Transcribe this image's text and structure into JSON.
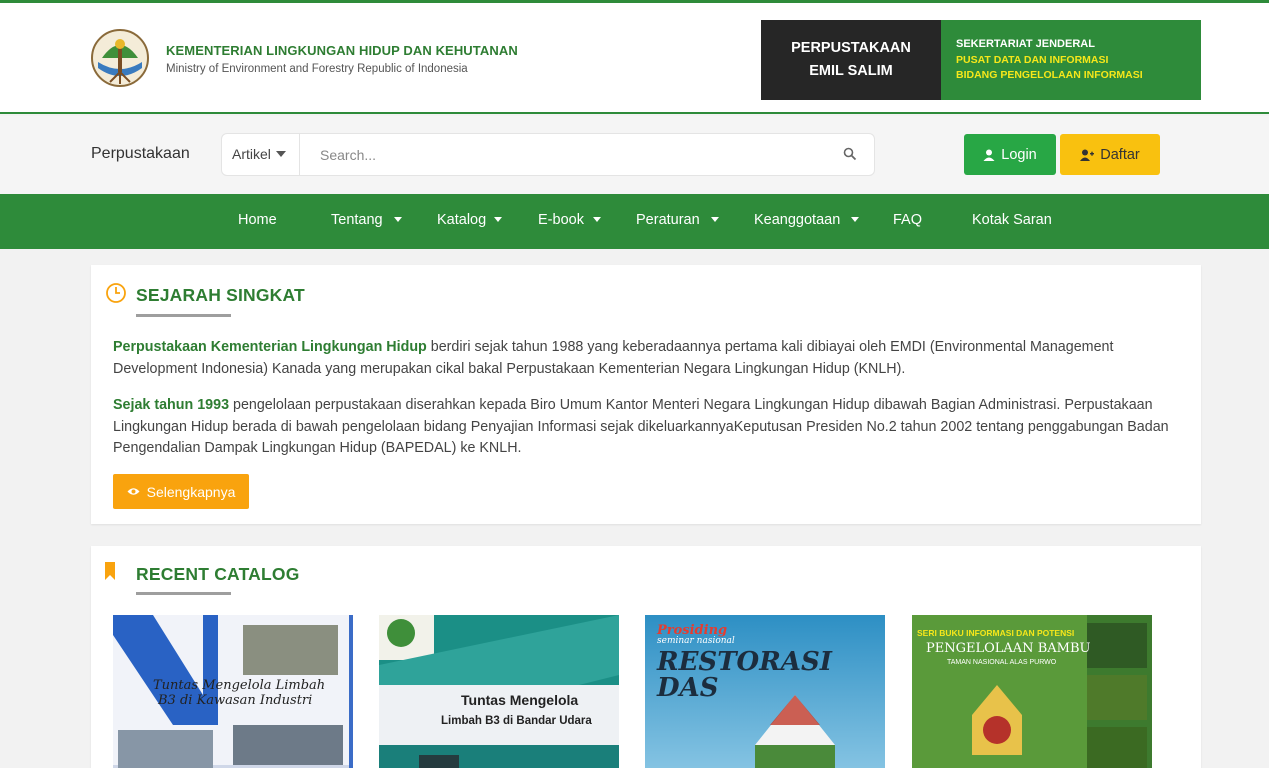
{
  "header": {
    "ministry_name": "KEMENTERIAN LINGKUNGAN HIDUP DAN KEHUTANAN",
    "ministry_subtitle": "Ministry of Environment and Forestry Republic of Indonesia",
    "library_line1": "PERPUSTAKAAN",
    "library_line2": "EMIL SALIM",
    "secretariat_line1": "SEKERTARIAT JENDERAL",
    "secretariat_line2": "PUSAT DATA DAN INFORMASI",
    "secretariat_line3": "BIDANG PENGELOLAAN INFORMASI"
  },
  "searchbar": {
    "brand": "Perpustakaan",
    "category": "Artikel",
    "placeholder": "Search...",
    "login_label": "Login",
    "register_label": "Daftar"
  },
  "nav": {
    "items": [
      {
        "label": "Home",
        "dropdown": false
      },
      {
        "label": "Tentang",
        "dropdown": true
      },
      {
        "label": "Katalog",
        "dropdown": true
      },
      {
        "label": "E-book",
        "dropdown": true
      },
      {
        "label": "Peraturan",
        "dropdown": true
      },
      {
        "label": "Keanggotaan",
        "dropdown": true
      },
      {
        "label": "FAQ",
        "dropdown": false
      },
      {
        "label": "Kotak Saran",
        "dropdown": false
      }
    ]
  },
  "history": {
    "title": "SEJARAH SINGKAT",
    "p1_bold": "Perpustakaan Kementerian Lingkungan Hidup",
    "p1_rest": " berdiri sejak tahun 1988 yang keberadaannya pertama kali dibiayai oleh EMDI (Environmental Management Development Indonesia) Kanada yang merupakan cikal bakal Perpustakaan Kementerian Negara Lingkungan Hidup (KNLH).",
    "p2_bold": "Sejak tahun 1993",
    "p2_rest": " pengelolaan perpustakaan diserahkan kepada Biro Umum Kantor Menteri Negara Lingkungan Hidup dibawah Bagian Administrasi. Perpustakaan Lingkungan Hidup berada di bawah pengelolaan bidang Penyajian Informasi sejak dikeluarkannyaKeputusan Presiden No.2 tahun 2002 tentang penggabungan Badan Pengendalian Dampak Lingkungan Hidup (BAPEDAL) ke KNLH.",
    "more_label": "Selengkapnya"
  },
  "catalog": {
    "title": "RECENT CATALOG",
    "books": [
      {
        "cover_line1": "Tuntas Mengelola Limbah",
        "cover_line2": "B3 di Kawasan Industri"
      },
      {
        "cover_line1": "Tuntas Mengelola",
        "cover_line2": "Limbah B3 di Bandar Udara"
      },
      {
        "cover_line1": "Prosiding",
        "cover_line2": "seminar nasional",
        "cover_line3": "RESTORASI",
        "cover_line4": "DAS"
      },
      {
        "cover_line1": "SERI BUKU INFORMASI DAN POTENSI",
        "cover_line2": "PENGELOLAAN BAMBU",
        "cover_line3": "TAMAN NASIONAL ALAS PURWO"
      }
    ]
  },
  "colors": {
    "primary_green": "#2e8b3a",
    "accent_yellow": "#f9c10f",
    "accent_orange": "#f9a30e",
    "dark": "#262626"
  }
}
